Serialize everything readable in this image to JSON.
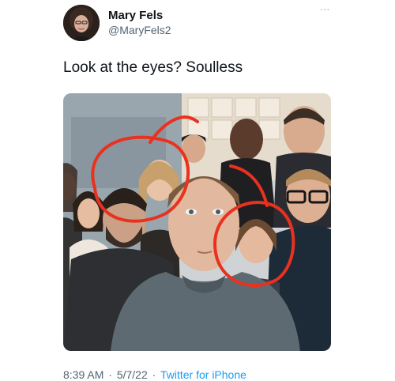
{
  "user": {
    "display_name": "Mary Fels",
    "handle": "@MaryFels2"
  },
  "tweet": {
    "text": "Look at the eyes? Soulless",
    "time": "8:39 AM",
    "date": "5/7/22",
    "separator": "·",
    "source": "Twitter for iPhone"
  },
  "icons": {
    "more": "more-options-icon",
    "more_glyph": "···"
  },
  "colors": {
    "link": "#1d9bf0",
    "annotation_circle": "#e8321f",
    "secondary_text": "#536471"
  }
}
